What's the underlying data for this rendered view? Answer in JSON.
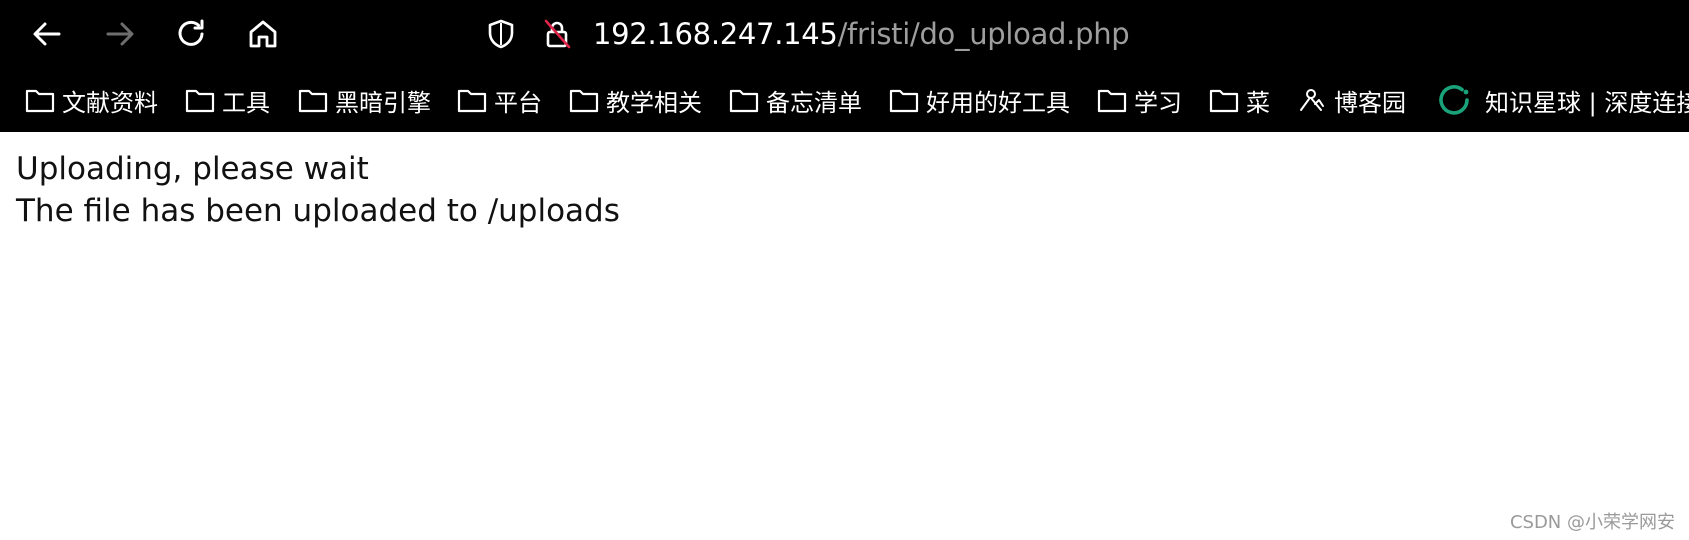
{
  "toolbar": {
    "url_host": "192.168.247.145",
    "url_path": "/fristi/do_upload.php",
    "back_icon": "arrow-left-icon",
    "forward_icon": "arrow-right-icon",
    "reload_icon": "reload-icon",
    "home_icon": "home-icon",
    "shield_icon": "shield-icon",
    "insecure_lock_icon": "lock-crossed-icon",
    "forward_color": "#6e6e6e",
    "insecure_slash_color": "#e0244a"
  },
  "bookmarks": [
    {
      "label": "文献资料",
      "icon": "folder-icon"
    },
    {
      "label": "工具",
      "icon": "folder-icon"
    },
    {
      "label": "黑暗引擎",
      "icon": "folder-icon"
    },
    {
      "label": "平台",
      "icon": "folder-icon"
    },
    {
      "label": "教学相关",
      "icon": "folder-icon"
    },
    {
      "label": "备忘清单",
      "icon": "folder-icon"
    },
    {
      "label": "好用的好工具",
      "icon": "folder-icon"
    },
    {
      "label": "学习",
      "icon": "folder-icon"
    },
    {
      "label": "菜",
      "icon": "folder-icon"
    },
    {
      "label": "博客园",
      "icon": "cnblogs-icon"
    },
    {
      "label": "知识星球 | 深度连接",
      "icon": "zsxq-icon",
      "icon_color": "#1aa37a"
    }
  ],
  "page": {
    "line1": "Uploading, please wait",
    "line2": "The file has been uploaded to /uploads"
  },
  "watermark": "CSDN @小荣学网安"
}
